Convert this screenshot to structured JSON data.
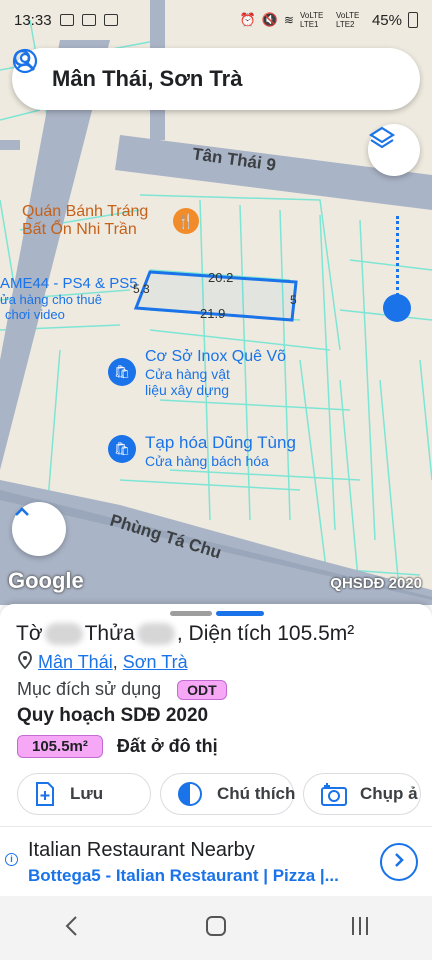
{
  "status_bar": {
    "time": "13:33",
    "signal1": "VoLTE LTE1",
    "signal2": "VoLTE LTE2",
    "battery": "45%"
  },
  "search": {
    "title": "Mân Thái, Sơn Trà"
  },
  "map": {
    "street_top": "Tân Thái 9",
    "street_bottom": "Phùng Tá Chu",
    "poi_restaurant_line1": "Quán Bánh Tráng",
    "poi_restaurant_line2": "Bất Ổn Nhi Trần",
    "poi_game_line1": "AME44 - PS4 & PS5",
    "poi_game_line2": "ửa hàng cho thuê",
    "poi_game_line3": "chơi video",
    "poi_inox_name": "Cơ Sở Inox Quê Võ",
    "poi_inox_cat1": "Cửa hàng vật",
    "poi_inox_cat2": "liệu xây dựng",
    "poi_grocery_name": "Tạp hóa Dũng Tùng",
    "poi_grocery_cat": "Cửa hàng bách hóa",
    "dim_top": "20.2",
    "dim_bottom": "21.9",
    "dim_left": "5.3",
    "dim_right": "5",
    "logo": "Google",
    "watermark": "QHSDĐ 2020"
  },
  "sheet": {
    "title_prefix": "Tờ",
    "title_mid": "Thửa",
    "title_suffix": ", Diện tích 105.5m²",
    "location_ward": "Mân Thái",
    "location_sep": ",",
    "location_district": "Sơn Trà",
    "purpose_label": "Mục đích sử dụng",
    "purpose_badge": "ODT",
    "planning_title": "Quy hoạch SDĐ 2020",
    "area_badge": "105.5m²",
    "land_type": "Đất ở đô thị",
    "btn_save": "Lưu",
    "btn_legend": "Chú thích",
    "btn_capture": "Chụp ả"
  },
  "ad": {
    "title": "Italian Restaurant Nearby",
    "subtitle": "Bottega5 - Italian Restaurant | Pizza |..."
  },
  "colors": {
    "accent": "#1a73e8",
    "badge": "#f6a8f7",
    "road": "#a9b4c6",
    "parcel_lines": "#7ee5d5"
  }
}
